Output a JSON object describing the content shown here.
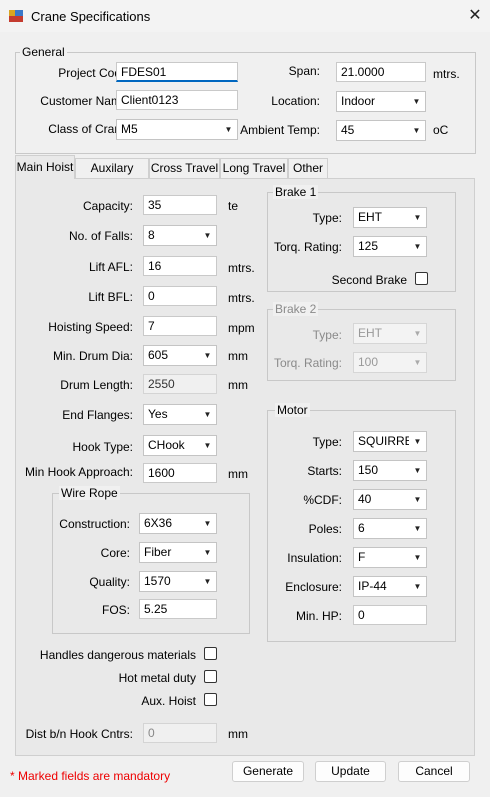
{
  "window": {
    "title": "Crane Specifications"
  },
  "general": {
    "legend": "General",
    "project_code_label": "Project Code:",
    "project_code": "FDES01",
    "customer_name_label": "Customer Name:",
    "customer_name": "Client0123",
    "class_label": "Class of Crane:",
    "class_value": "M5",
    "span_label": "Span:",
    "span_value": "21.0000",
    "span_unit": "mtrs.",
    "location_label": "Location:",
    "location_value": "Indoor",
    "ambient_label": "Ambient Temp:",
    "ambient_value": "45",
    "ambient_unit": "oC"
  },
  "tabs": [
    {
      "label": "Main Hoist",
      "active": true
    },
    {
      "label": "Auxilary Hoist"
    },
    {
      "label": "Cross Travel"
    },
    {
      "label": "Long Travel"
    },
    {
      "label": "Other"
    }
  ],
  "hoist": {
    "capacity_label": "Capacity:",
    "capacity": "35",
    "capacity_unit": "te",
    "falls_label": "No. of Falls:",
    "falls": "8",
    "lift_afl_label": "Lift AFL:",
    "lift_afl": "16",
    "lift_afl_unit": "mtrs.",
    "lift_bfl_label": "Lift BFL:",
    "lift_bfl": "0",
    "lift_bfl_unit": "mtrs.",
    "hoisting_speed_label": "Hoisting Speed:",
    "hoisting_speed": "7",
    "hoisting_speed_unit": "mpm",
    "drum_dia_label": "Min. Drum Dia:",
    "drum_dia": "605",
    "drum_dia_unit": "mm",
    "drum_length_label": "Drum Length:",
    "drum_length": "2550",
    "drum_length_unit": "mm",
    "end_flanges_label": "End Flanges:",
    "end_flanges": "Yes",
    "hook_type_label": "Hook Type:",
    "hook_type": "CHook",
    "hook_approach_label": "Min Hook Approach:",
    "hook_approach": "1600",
    "hook_approach_unit": "mm"
  },
  "wire_rope": {
    "legend": "Wire Rope",
    "construction_label": "Construction:",
    "construction": "6X36",
    "core_label": "Core:",
    "core": "Fiber",
    "quality_label": "Quality:",
    "quality": "1570",
    "fos_label": "FOS:",
    "fos": "5.25"
  },
  "options": {
    "dangerous_label": "Handles dangerous materials",
    "dangerous": false,
    "hot_metal_label": "Hot metal duty",
    "hot_metal": false,
    "aux_hoist_label": "Aux. Hoist",
    "aux_hoist": false,
    "dist_label": "Dist b/n Hook Cntrs:",
    "dist_value": "0",
    "dist_unit": "mm"
  },
  "brake1": {
    "legend": "Brake 1",
    "type_label": "Type:",
    "type": "EHT",
    "torque_label": "Torq. Rating:",
    "torque": "125",
    "second_brake_label": "Second Brake",
    "second_brake": false
  },
  "brake2": {
    "legend": "Brake 2",
    "type_label": "Type:",
    "type": "EHT",
    "torque_label": "Torq. Rating:",
    "torque": "100"
  },
  "motor": {
    "legend": "Motor",
    "type_label": "Type:",
    "type": "SQUIRREI",
    "starts_label": "Starts:",
    "starts": "150",
    "cdf_label": "%CDF:",
    "cdf": "40",
    "poles_label": "Poles:",
    "poles": "6",
    "insulation_label": "Insulation:",
    "insulation": "F",
    "enclosure_label": "Enclosure:",
    "enclosure": "IP-44",
    "min_hp_label": "Min. HP:",
    "min_hp": "0"
  },
  "footer": {
    "mandatory_note": "* Marked fields are mandatory",
    "generate": "Generate",
    "update": "Update",
    "cancel": "Cancel"
  },
  "colors": {
    "accent": "#0067c0",
    "mandatory": "#e00000"
  },
  "icons": {
    "app": "app-icon",
    "close": "close-icon",
    "dropdown": "chevron-down-icon"
  }
}
